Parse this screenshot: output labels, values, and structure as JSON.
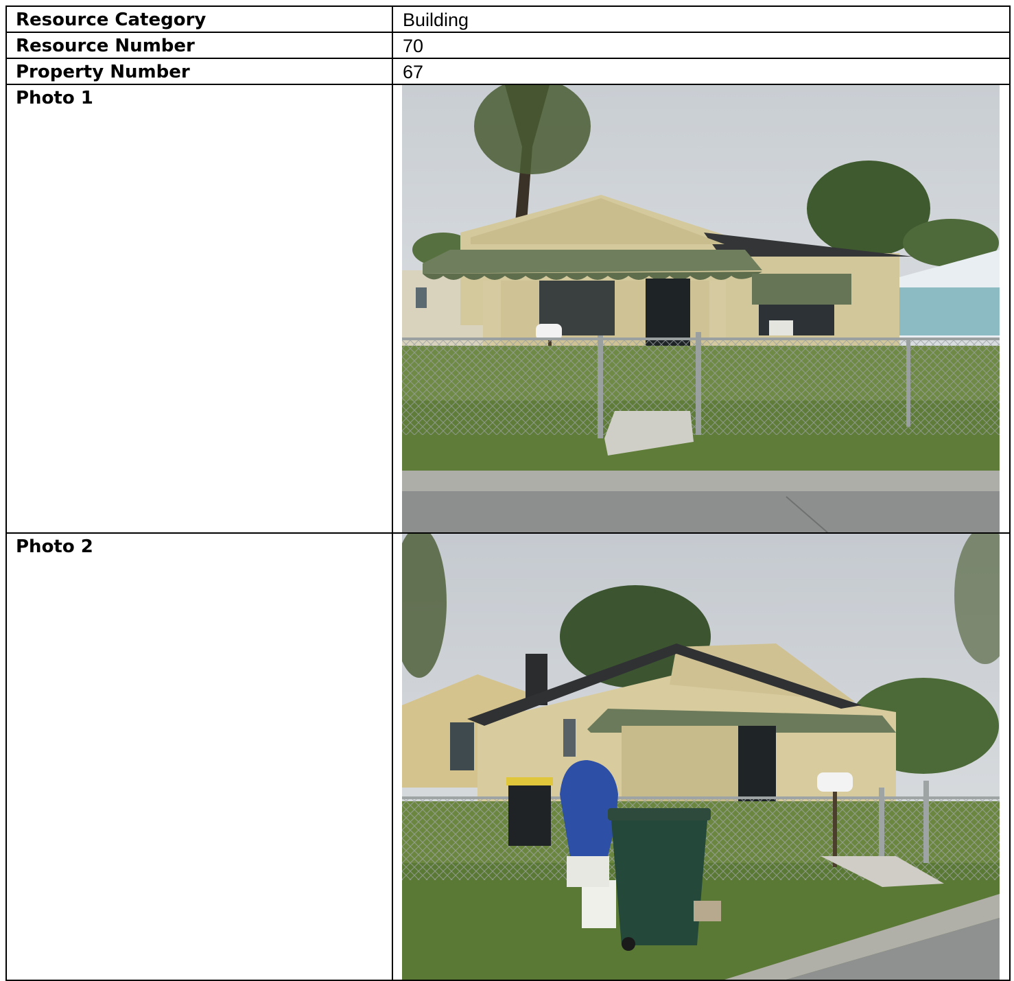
{
  "table": {
    "rows": [
      {
        "label": "Resource Category",
        "value": "Building"
      },
      {
        "label": "Resource Number",
        "value": "70"
      },
      {
        "label": "Property Number",
        "value": "67"
      }
    ],
    "photos": [
      {
        "label": "Photo 1"
      },
      {
        "label": "Photo 2"
      }
    ]
  }
}
